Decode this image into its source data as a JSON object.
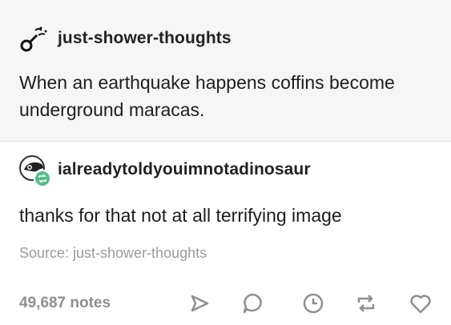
{
  "post": {
    "username": "just-shower-thoughts",
    "text": "When an earthquake happens coffins become\nunderground maracas.",
    "avatar_icon": "shower-head-icon"
  },
  "reply": {
    "username": "ialreadytoldyouimnotadinosaur",
    "text": "thanks for that not at all terrifying image",
    "avatar_icon": "dinosaur-avatar-icon",
    "source_text": "Source: just-shower-thoughts"
  },
  "footer": {
    "notes": "49,687 notes",
    "icons": [
      "share-icon",
      "reply-icon",
      "queue-clock-icon",
      "reblog-icon",
      "like-heart-icon"
    ]
  },
  "colors": {
    "top_background": "#f6f6f6",
    "reblog_badge": "#56bc8a",
    "muted_text": "#9a9a9a"
  }
}
